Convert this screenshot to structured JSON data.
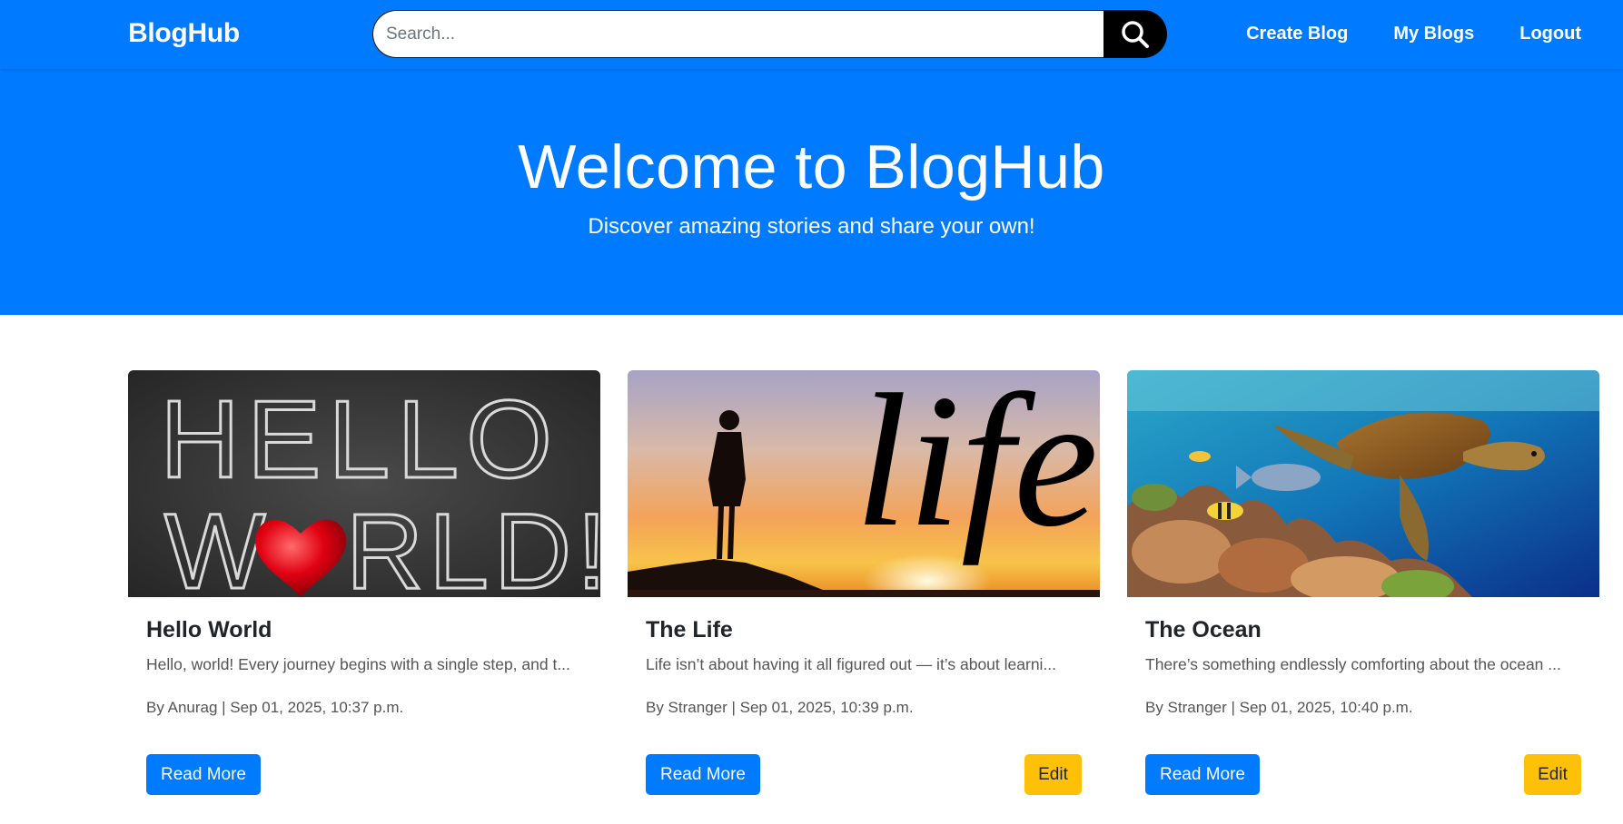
{
  "navbar": {
    "brand": "BlogHub",
    "search": {
      "placeholder": "Search...",
      "value": ""
    },
    "links": [
      "Create Blog",
      "My Blogs",
      "Logout"
    ]
  },
  "hero": {
    "title": "Welcome to BlogHub",
    "subtitle": "Discover amazing stories and share your own!"
  },
  "posts": [
    {
      "title": "Hello World",
      "excerpt": "Hello, world! Every journey begins with a single step, and t...",
      "meta": "By Anurag | Sep 01, 2025, 10:37 p.m.",
      "read_label": "Read More",
      "image_text": [
        "HELLO",
        "W",
        "RLD!"
      ]
    },
    {
      "title": "The Life",
      "excerpt": "Life isn’t about having it all figured out — it’s about learni...",
      "meta": "By Stranger | Sep 01, 2025, 10:39 p.m.",
      "read_label": "Read More",
      "edit_label": "Edit",
      "image_text": "life"
    },
    {
      "title": "The Ocean",
      "excerpt": "There’s something endlessly comforting about the ocean ...",
      "meta": "By Stranger | Sep 01, 2025, 10:40 p.m.",
      "read_label": "Read More",
      "edit_label": "Edit"
    }
  ],
  "colors": {
    "primary": "#007bff",
    "warning": "#ffc107",
    "search_button": "#000000"
  },
  "icons": {
    "search_button": "search-icon"
  }
}
